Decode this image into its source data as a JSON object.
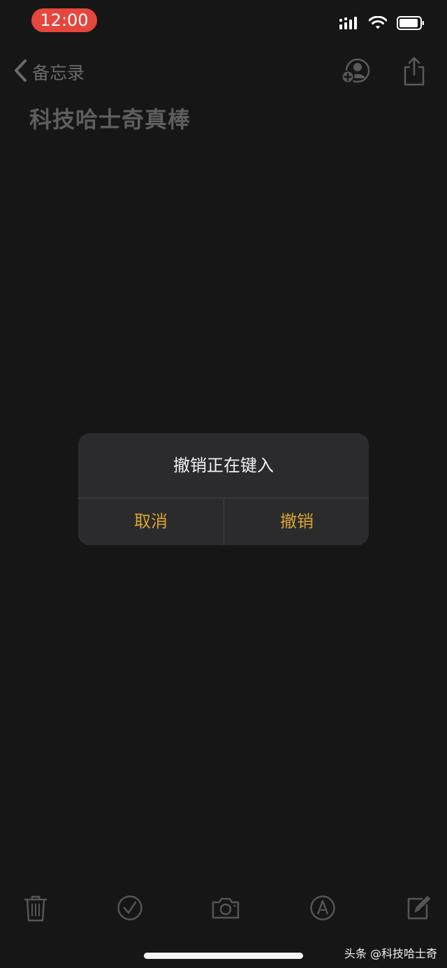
{
  "status_bar": {
    "time": "12:00",
    "icons": [
      "cellular-signal-icon",
      "wifi-icon",
      "battery-icon"
    ]
  },
  "nav": {
    "back_label": "备忘录",
    "right_icons": [
      "add-people-icon",
      "share-icon"
    ]
  },
  "note": {
    "title": "科技哈士奇真棒"
  },
  "alert": {
    "title": "撤销正在键入",
    "cancel_label": "取消",
    "confirm_label": "撤销"
  },
  "toolbar": {
    "icons": [
      "trash-icon",
      "checklist-icon",
      "camera-icon",
      "markup-icon",
      "compose-icon"
    ]
  },
  "watermark": "头条 @科技哈士奇",
  "colors": {
    "background": "#161616",
    "accent": "#d9a52c",
    "time_pill": "#e5473c",
    "dialog": "#2b2b2d",
    "dim_icon": "#5a5a5a"
  }
}
